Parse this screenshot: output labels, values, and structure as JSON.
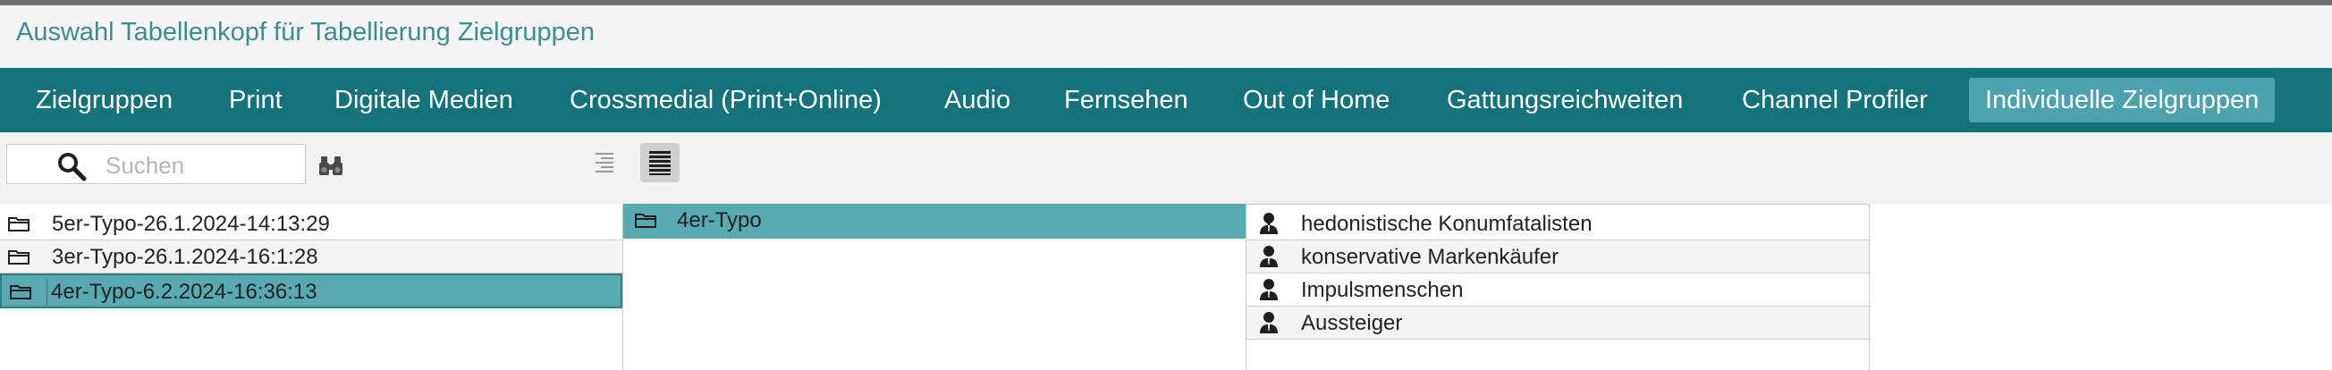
{
  "window": {
    "title": "Auswahl Tabellenkopf für Tabellierung Zielgruppen"
  },
  "nav": {
    "items": [
      {
        "label": "Zielgruppen"
      },
      {
        "label": "Print"
      },
      {
        "label": "Digitale Medien"
      },
      {
        "label": "Crossmedial (Print+Online)"
      },
      {
        "label": "Audio"
      },
      {
        "label": "Fernsehen"
      },
      {
        "label": "Out of Home"
      },
      {
        "label": "Gattungsreichweiten"
      },
      {
        "label": "Channel Profiler"
      },
      {
        "label": "Individuelle Zielgruppen"
      }
    ],
    "active_index": 9
  },
  "toolbar": {
    "search": {
      "placeholder": "Suchen",
      "value": ""
    },
    "icons": {
      "search": "magnifier-icon",
      "find": "binoculars-icon",
      "indent": "indent-list-icon",
      "full_list": "full-list-icon"
    }
  },
  "panels": {
    "folders": [
      {
        "label": "5er-Typo-26.1.2024-14:13:29",
        "icon": "folder-icon"
      },
      {
        "label": "3er-Typo-26.1.2024-16:1:28",
        "icon": "folder-icon"
      },
      {
        "label": "4er-Typo-6.2.2024-16:36:13",
        "icon": "folder-icon",
        "selected": true
      }
    ],
    "subfolders": [
      {
        "label": "4er-Typo",
        "icon": "folder-icon",
        "selected": true
      }
    ],
    "items": [
      {
        "label": "hedonistische Konumfatalisten",
        "icon": "person-icon"
      },
      {
        "label": "konservative Markenkäufer",
        "icon": "person-icon"
      },
      {
        "label": "Impulsmenschen",
        "icon": "person-icon"
      },
      {
        "label": "Aussteiger",
        "icon": "person-icon"
      }
    ]
  },
  "colors": {
    "accent": "#14727b",
    "title_text": "#3c8c96",
    "selected_row": "#58a9b1",
    "active_nav": "#4da3ad"
  }
}
